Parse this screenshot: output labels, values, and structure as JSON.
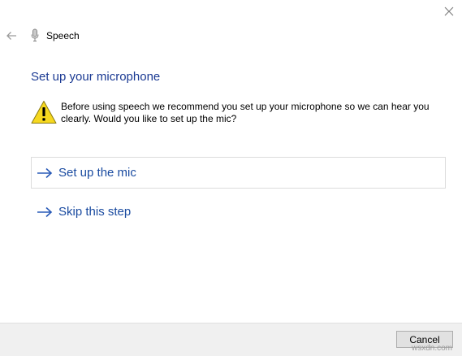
{
  "window": {
    "close_icon": "close-icon",
    "back_icon": "back-arrow-icon"
  },
  "header": {
    "icon": "microphone-icon",
    "title": "Speech"
  },
  "main": {
    "heading": "Set up your microphone",
    "warning_icon": "warning-icon",
    "message": "Before using speech we recommend you set up your microphone so we can hear you clearly.  Would you like to set up the mic?",
    "options": [
      {
        "label": "Set up the mic",
        "icon": "arrow-right-icon"
      },
      {
        "label": "Skip this step",
        "icon": "arrow-right-icon"
      }
    ]
  },
  "footer": {
    "cancel_label": "Cancel"
  },
  "watermark": "wsxdn.com",
  "colors": {
    "heading": "#1b3a93",
    "link": "#1a4ba0",
    "footer_bg": "#f0f0f0",
    "warning_fill": "#f6d81f"
  }
}
